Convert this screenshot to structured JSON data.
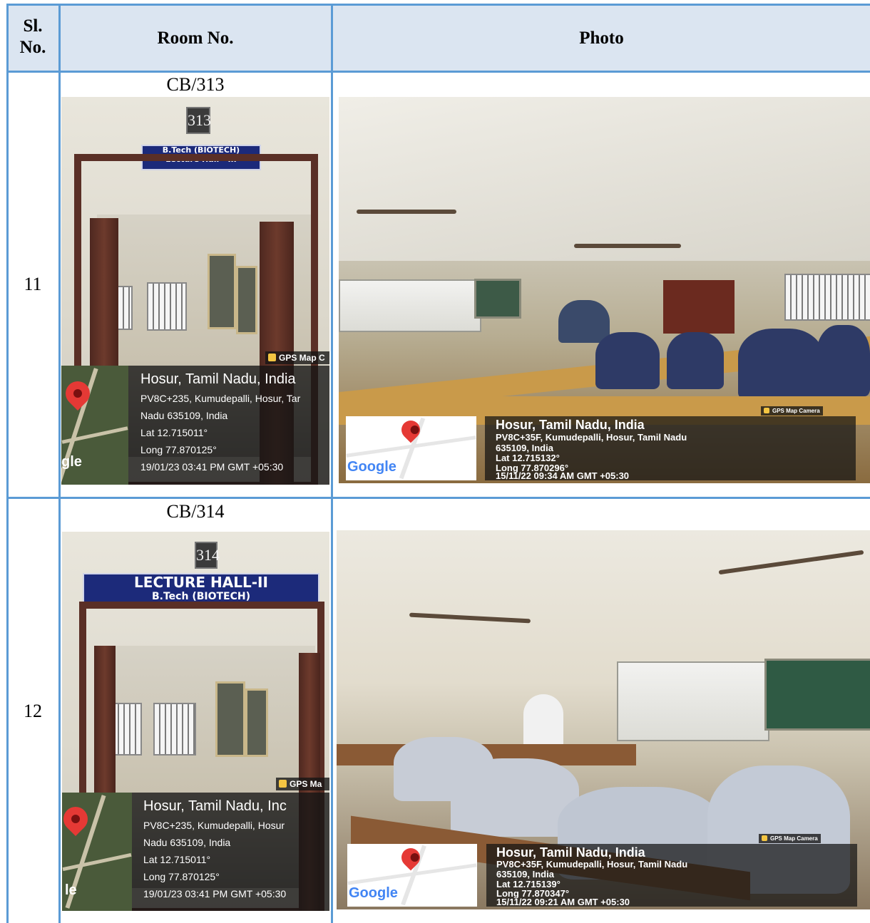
{
  "table": {
    "headers": {
      "sl_no": "Sl.\nNo.",
      "room_no": "Room No.",
      "photo": "Photo"
    },
    "rows": [
      {
        "sl_no": "11",
        "room_no": "CB/313",
        "door_photo": {
          "room_number_plate": "313",
          "sign_line1": "B.Tech (BIOTECH)",
          "sign_line2": "Lecture Hall - III",
          "gps_app": "GPS Map C",
          "location": "Hosur, Tamil Nadu, India",
          "address_line1": "PV8C+235, Kumudepalli, Hosur, Tar",
          "address_line2": "Nadu 635109, India",
          "lat": "Lat 12.715011°",
          "long": "Long 77.870125°",
          "timestamp": "19/01/23 03:41 PM GMT +05:30",
          "map_logo": "gle"
        },
        "class_photo": {
          "gps_app": "GPS Map Camera",
          "location": "Hosur, Tamil Nadu, India",
          "address_line1": "PV8C+35F, Kumudepalli, Hosur, Tamil Nadu",
          "address_line2": "635109, India",
          "lat": "Lat 12.715132°",
          "long": "Long 77.870296°",
          "timestamp": "15/11/22 09:34 AM GMT +05:30",
          "map_logo": "Google"
        }
      },
      {
        "sl_no": "12",
        "room_no": "CB/314",
        "door_photo": {
          "room_number_plate": "314",
          "sign_line1": "LECTURE HALL-II",
          "sign_line2": "B.Tech (BIOTECH)",
          "gps_app": "GPS Ma",
          "location": "Hosur, Tamil Nadu, Inc",
          "address_line1": "PV8C+235, Kumudepalli, Hosur",
          "address_line2": "Nadu 635109, India",
          "lat": "Lat 12.715011°",
          "long": "Long 77.870125°",
          "timestamp": "19/01/23 03:41 PM GMT +05:30",
          "map_logo": "le"
        },
        "class_photo": {
          "gps_app": "GPS Map Camera",
          "location": "Hosur, Tamil Nadu, India",
          "address_line1": "PV8C+35F, Kumudepalli, Hosur, Tamil Nadu",
          "address_line2": "635109, India",
          "lat": "Lat 12.715139°",
          "long": "Long 77.870347°",
          "timestamp": "15/11/22 09:21 AM GMT +05:30",
          "map_logo": "Google"
        }
      }
    ]
  },
  "colors": {
    "grid": "#5b9bd5",
    "header_fill": "#dbe5f1",
    "gps_pin": "#e53935",
    "sign_blue": "#1c2a7a"
  }
}
